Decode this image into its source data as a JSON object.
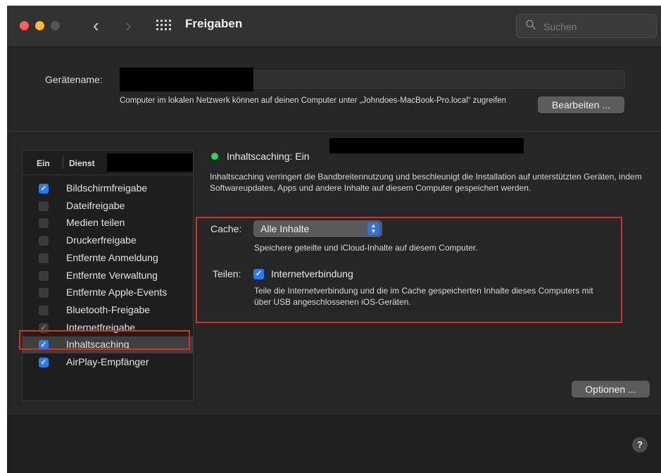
{
  "window": {
    "title": "Freigaben"
  },
  "toolbar": {
    "back": "‹",
    "forward": "›"
  },
  "search": {
    "placeholder": "Suchen"
  },
  "device": {
    "name_label": "Gerätename:",
    "host_text": "Computer im lokalen Netzwerk können auf deinen Computer unter „Johndoes-MacBook-Pro.local“ zugreifen",
    "edit_button": "Bearbeiten ..."
  },
  "services": {
    "col_on": "Ein",
    "col_service": "Dienst",
    "items": [
      {
        "label": "Bildschirmfreigabe",
        "checked": true,
        "enabled": true,
        "selected": false
      },
      {
        "label": "Dateifreigabe",
        "checked": false,
        "enabled": true,
        "selected": false
      },
      {
        "label": "Medien teilen",
        "checked": false,
        "enabled": true,
        "selected": false
      },
      {
        "label": "Druckerfreigabe",
        "checked": false,
        "enabled": true,
        "selected": false
      },
      {
        "label": "Entfernte Anmeldung",
        "checked": false,
        "enabled": true,
        "selected": false
      },
      {
        "label": "Entfernte Verwaltung",
        "checked": false,
        "enabled": true,
        "selected": false
      },
      {
        "label": "Entfernte Apple-Events",
        "checked": false,
        "enabled": true,
        "selected": false
      },
      {
        "label": "Bluetooth-Freigabe",
        "checked": false,
        "enabled": true,
        "selected": false
      },
      {
        "label": "Internetfreigabe",
        "checked": true,
        "enabled": false,
        "selected": false
      },
      {
        "label": "Inhaltscaching",
        "checked": true,
        "enabled": true,
        "selected": true
      },
      {
        "label": "AirPlay-Empfänger",
        "checked": true,
        "enabled": true,
        "selected": false
      }
    ]
  },
  "detail": {
    "status": "Inhaltscaching: Ein",
    "status_color": "#30d158",
    "description": "Inhaltscaching verringert die Bandbreitennutzung und beschleunigt die Installation auf unterstützten Geräten, indem Softwareupdates, Apps und andere Inhalte auf diesem Computer gespeichert werden.",
    "cache_label": "Cache:",
    "cache_value": "Alle Inhalte",
    "cache_hint": "Speichere geteilte und iCloud-Inhalte auf diesem Computer.",
    "share_label": "Teilen:",
    "share_value": "Internetverbindung",
    "share_checked": true,
    "share_hint": "Teile die Internetverbindung und die im Cache gespeicherten Inhalte dieses Computers mit über USB angeschlossenen iOS-Geräten.",
    "options_button": "Optionen ..."
  },
  "help": {
    "label": "?"
  },
  "colors": {
    "accent": "#2a7af5",
    "highlight": "#d93025"
  }
}
